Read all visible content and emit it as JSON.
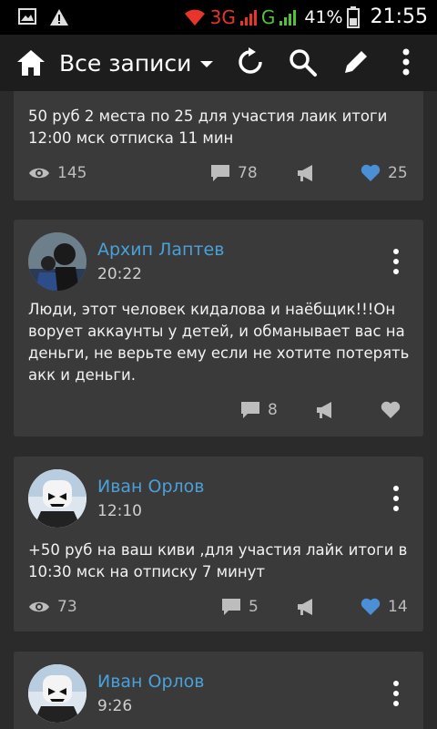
{
  "status_bar": {
    "network_3g": "3G",
    "network_g": "G",
    "battery": "41%",
    "time": "21:55",
    "colors": {
      "red": "#e8342a",
      "green": "#52c337"
    }
  },
  "app_bar": {
    "title": "Все записи",
    "icons": [
      "home-icon",
      "refresh-icon",
      "search-icon",
      "edit-icon",
      "more-vert-icon"
    ]
  },
  "posts": [
    {
      "text": "50 руб 2 места по 25 для участия  лаик итоги 12:00 мск отписка 11 мин",
      "views": "145",
      "comments": "78",
      "likes": "25"
    },
    {
      "author": "Архип Лаптев",
      "time": "20:22",
      "text": "Люди, этот человек кидалова и наёбщик!!!Он ворует аккаунты у детей, и обманывает вас на деньги, не верьте ему если не хотите потерять акк и деньги.",
      "comments": "8"
    },
    {
      "author": "Иван Орлов",
      "time": "12:10",
      "text": "+50 руб на ваш киви ,для участия лайк итоги в 10:30 мск на отписку 7 минут",
      "views": "73",
      "comments": "5",
      "likes": "14"
    },
    {
      "author": "Иван Орлов",
      "time": "9:26"
    }
  ],
  "colors": {
    "background": "#2b2b2b",
    "card": "#3a3a3a",
    "author": "#4ba0d8",
    "liked": "#4b8fd6"
  }
}
